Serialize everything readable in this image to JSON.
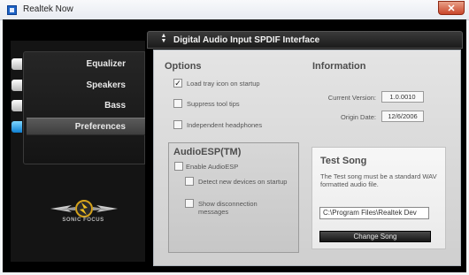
{
  "window": {
    "title": "Realtek Now",
    "close_glyph": "✕"
  },
  "header": {
    "arrows_icon": "up-down-arrows-icon",
    "label": "Digital Audio Input SPDIF Interface"
  },
  "nav": {
    "items": [
      {
        "label": "Equalizer",
        "selected": false
      },
      {
        "label": "Speakers",
        "selected": false
      },
      {
        "label": "Bass",
        "selected": false
      },
      {
        "label": "Preferences",
        "selected": true
      }
    ]
  },
  "logo": {
    "text": "SONIC FOCUS"
  },
  "options": {
    "heading": "Options",
    "items": [
      {
        "label": "Load tray icon on startup",
        "checked": true
      },
      {
        "label": "Suppress tool tips",
        "checked": false
      },
      {
        "label": "Independent headphones",
        "checked": false
      }
    ]
  },
  "information": {
    "heading": "Information",
    "current_version_label": "Current Version:",
    "current_version_value": "1.0.0010",
    "origin_date_label": "Origin Date:",
    "origin_date_value": "12/6/2006"
  },
  "audioesp": {
    "heading": "AudioESP(TM)",
    "enable_label": "Enable AudioESP",
    "detect_label": "Detect new devices on startup",
    "show_label": "Show disconnection messages"
  },
  "test_song": {
    "heading": "Test Song",
    "description": "The Test song must be a standard WAV formatted audio file.",
    "path": "C:\\Program Files\\Realtek Dev",
    "change_button": "Change Song"
  },
  "colors": {
    "accent_tab": "#1e90e0",
    "panel_bg": "#000000",
    "content_bg": "#dcdcdc"
  }
}
